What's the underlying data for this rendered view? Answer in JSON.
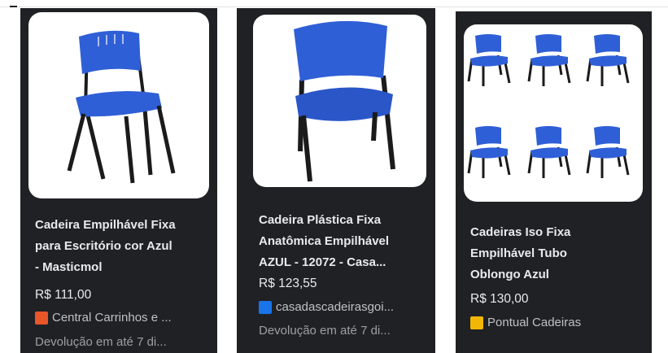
{
  "products": [
    {
      "title_lines": [
        "Cadeira Empilhável Fixa",
        "para Escritório cor Azul",
        "- Masticmol"
      ],
      "price": "R$ 111,00",
      "store": "Central Carrinhos e ...",
      "store_logo_color": "#e8562a",
      "return_text": "Devolução em até 7 di..."
    },
    {
      "title_lines": [
        "Cadeira Plástica Fixa",
        "Anatômica Empilhável",
        "AZUL - 12072 - Casa..."
      ],
      "price": "R$ 123,55",
      "store": "casadascadeirasgoi...",
      "store_logo_color": "#1a73e8",
      "return_text": "Devolução em até 7 di..."
    },
    {
      "title_lines": [
        "Cadeiras Iso Fixa",
        "Empilhável Tubo",
        "Oblongo Azul"
      ],
      "price": "R$ 130,00",
      "store": "Pontual Cadeiras",
      "store_logo_color": "#f2b705"
    }
  ],
  "colors": {
    "card_bg": "#202124",
    "chair_blue": "#2f5fd6",
    "chair_frame": "#1b1b1b"
  }
}
